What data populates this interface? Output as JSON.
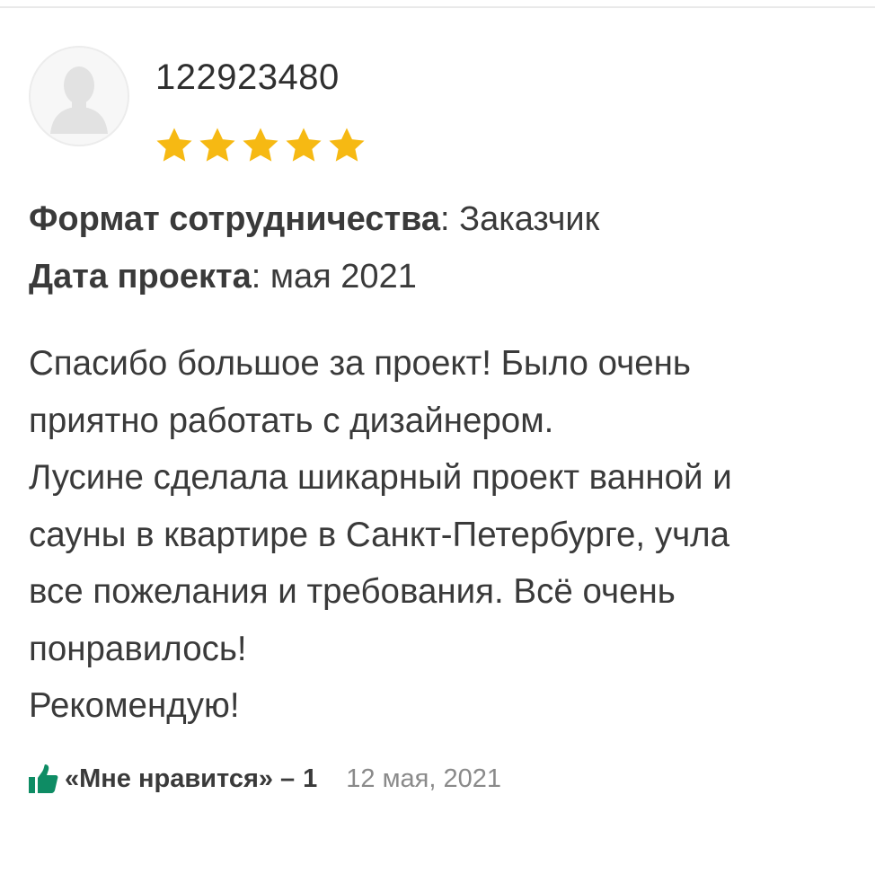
{
  "review": {
    "author": {
      "name": "122923480",
      "avatar_icon": "user-silhouette-icon"
    },
    "rating": {
      "stars": 5,
      "max": 5,
      "star_color": "#f6b913"
    },
    "meta": {
      "format_key": "Формат сотрудничества",
      "format_value": "Заказчик",
      "date_key": "Дата проекта",
      "date_value": "мая 2021"
    },
    "text_lines": [
      "Спасибо большое за проект! Было очень",
      "приятно работать с дизайнером.",
      "Лусине сделала шикарный проект ванной и",
      "сауны в квартире в Санкт-Петербурге, учла",
      "все пожелания и требования. Всё очень",
      "понравилось!",
      "Рекомендую!"
    ],
    "footer": {
      "like_icon": "thumbs-up-icon",
      "like_color": "#0e8c64",
      "like_label": "«Мне нравится»",
      "like_separator": "–",
      "like_count": "1",
      "date": "12 мая, 2021"
    }
  }
}
